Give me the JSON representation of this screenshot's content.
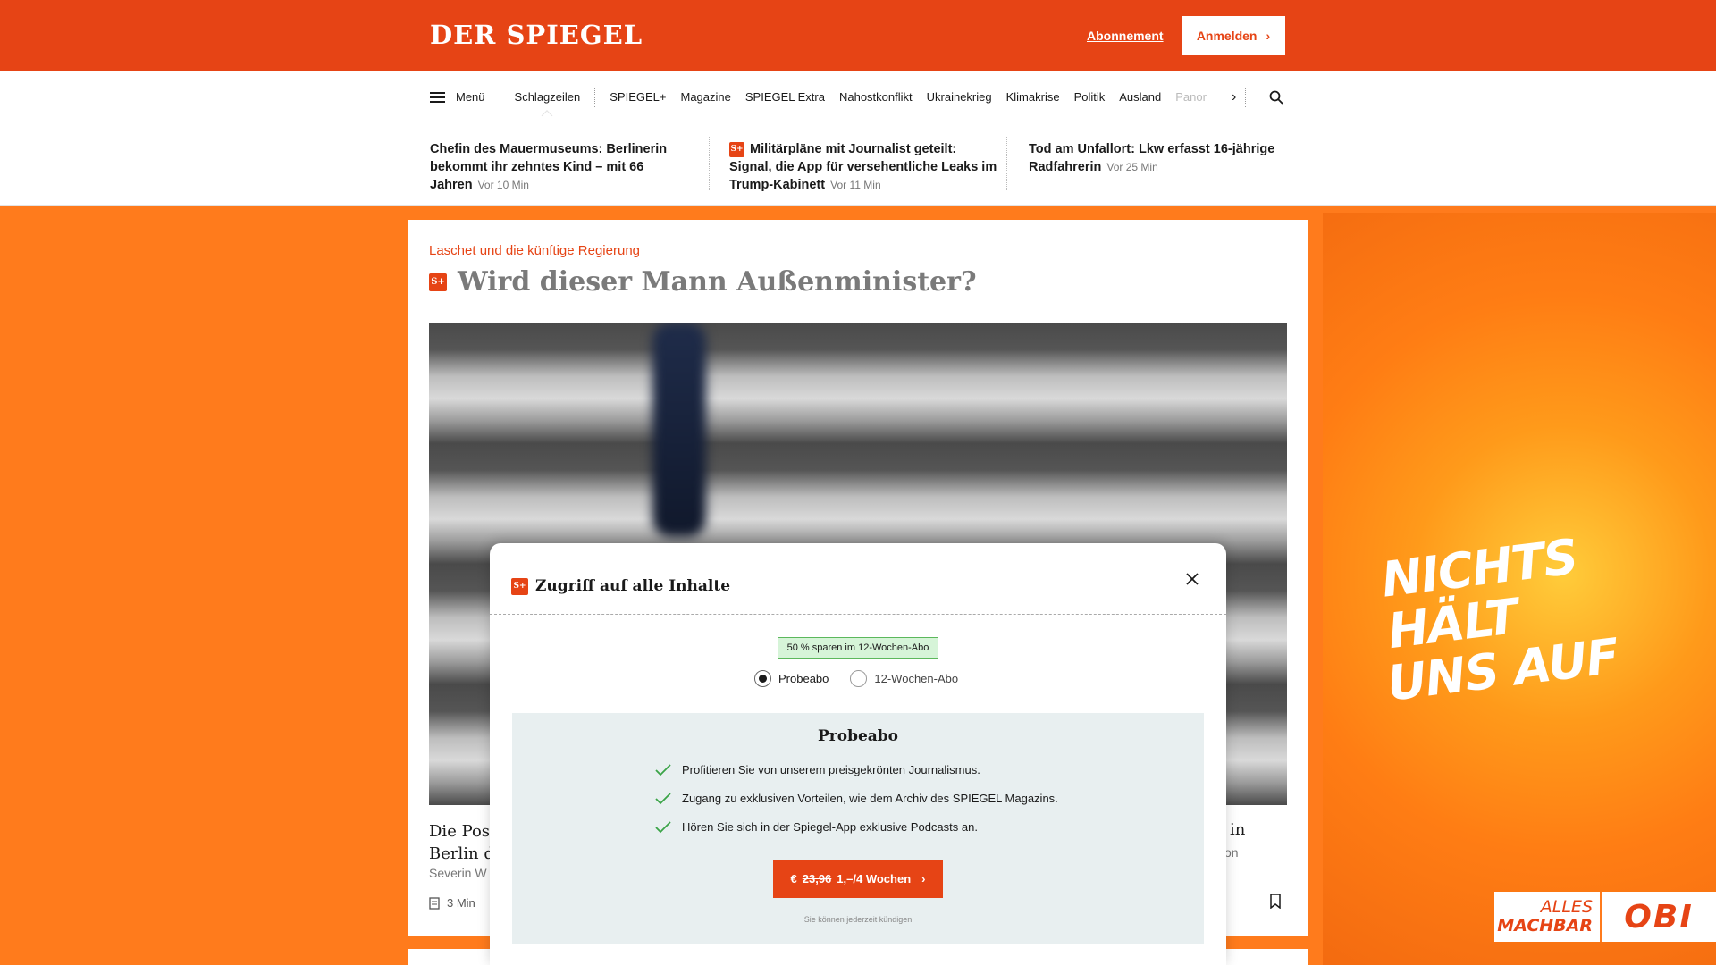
{
  "header": {
    "logo": "DER SPIEGEL",
    "subscription_link": "Abonnement",
    "login_button": "Anmelden"
  },
  "nav": {
    "menu_label": "Menü",
    "items": [
      "Schlagzeilen",
      "SPIEGEL+",
      "Magazine",
      "SPIEGEL Extra",
      "Nahostkonflikt",
      "Ukrainekrieg",
      "Klimakrise",
      "Politik",
      "Ausland",
      "Panor"
    ]
  },
  "teasers": [
    {
      "title": "Chefin des Mauermuseums: Berlinerin bekommt ihr zehntes Kind – mit 66 Jahren",
      "time": "Vor 10 Min",
      "plus": false
    },
    {
      "title": "Militärpläne mit Journalist geteilt: Signal, die App für versehentliche Leaks im Trump-Kabinett",
      "time": "Vor 11 Min",
      "plus": true
    },
    {
      "title": "Tod am Unfallort: Lkw erfasst 16-jährige Radfahrerin",
      "time": "Vor 25 Min",
      "plus": false
    }
  ],
  "article": {
    "kicker": "Laschet und die künftige Regierung",
    "headline": "Wird dieser Mann Außenminister?",
    "title_line1": "Die Post",
    "title_line2": "Berlin de",
    "author": "Severin W",
    "read_time": "3 Min",
    "title_right": "t in",
    "author_right": "on"
  },
  "ad": {
    "slogan_line1": "NICHTS HÄLT",
    "slogan_line2": "UNS AUF",
    "brand_line1": "ALLES",
    "brand_line2": "MACHBAR",
    "brand_logo": "OBI"
  },
  "modal": {
    "title": "Zugriff auf alle Inhalte",
    "badge": "50 % sparen im 12-Wochen-Abo",
    "options": [
      "Probeabo",
      "12-Wochen-Abo"
    ],
    "selected_option": "Probeabo",
    "plan_title": "Probeabo",
    "benefits": [
      "Profitieren Sie von unserem preisgekrönten Journalismus.",
      "Zugang zu exklusiven Vorteilen, wie dem Archiv des SPIEGEL Magazins.",
      "Hören Sie sich in der Spiegel-App exklusive Podcasts an."
    ],
    "cta_currency": "€",
    "cta_old_price": "23,96",
    "cta_new_price": "1,–/4 Wochen",
    "cancel_note": "Sie können jederzeit kündigen"
  },
  "colors": {
    "brand": "#e64415",
    "ad_orange": "#ff7b1c",
    "plan_bg": "#e8eff0",
    "check_green": "#3aa447"
  }
}
